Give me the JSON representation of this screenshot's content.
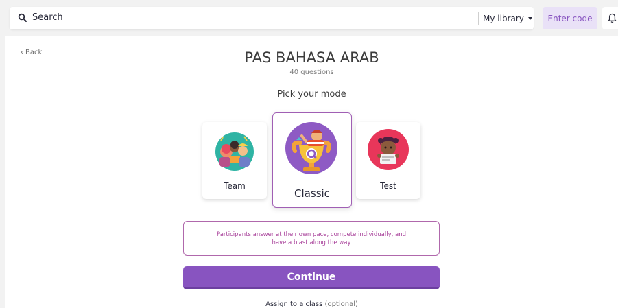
{
  "header": {
    "search_label": "Search",
    "library_label": "My library",
    "enter_code_label": "Enter code"
  },
  "nav": {
    "back_label": "Back"
  },
  "quiz": {
    "title": "PAS BAHASA ARAB",
    "subtitle": "40 questions"
  },
  "mode_picker": {
    "prompt": "Pick your mode",
    "modes": [
      {
        "label": "Team",
        "icon": "team-illustration"
      },
      {
        "label": "Classic",
        "icon": "classic-illustration",
        "selected": true
      },
      {
        "label": "Test",
        "icon": "test-illustration"
      }
    ],
    "description": "Participants answer at their own pace, compete individually, and have a blast along the way"
  },
  "actions": {
    "continue_label": "Continue",
    "assign_label": "Assign to a class",
    "assign_optional": "(optional)"
  },
  "colors": {
    "accent": "#8854c0",
    "accent_light": "#e9e1f7",
    "selected_border": "#a05fb4",
    "description_text": "#a8409a"
  }
}
